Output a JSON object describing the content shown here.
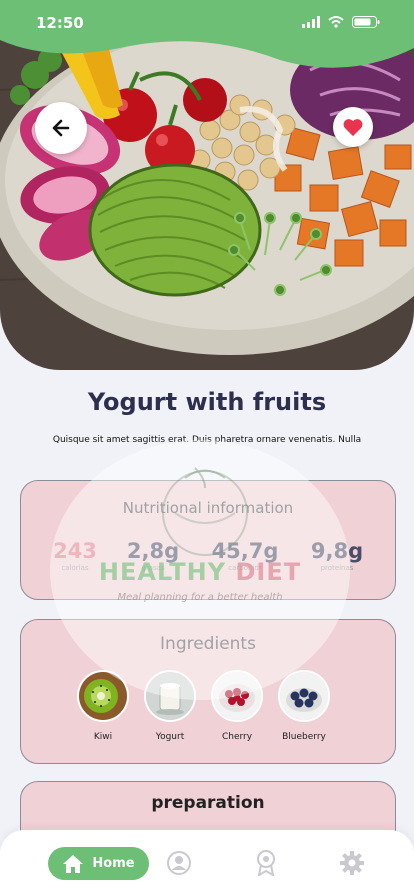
{
  "status": {
    "time": "12:50"
  },
  "recipe": {
    "title": "Yogurt with fruits",
    "description": "Quisque sit amet sagittis erat. Duis pharetra ornare venenatis. Nulla"
  },
  "nutrition": {
    "title": "Nutritional information",
    "items": [
      {
        "value": "243",
        "label": "calorias",
        "color": "#e07a88"
      },
      {
        "value": "2,8g",
        "label": "grasas",
        "color": "#4a4d66"
      },
      {
        "value": "45,7g",
        "label": "carbohidr",
        "color": "#4a4d66"
      },
      {
        "value": "9,8g",
        "label": "proteínas",
        "color": "#4a4d66"
      }
    ]
  },
  "ingredients": {
    "title": "Ingredients",
    "items": [
      {
        "label": "Kiwi",
        "icon": "kiwi-image"
      },
      {
        "label": "Yogurt",
        "icon": "yogurt-image"
      },
      {
        "label": "Cherry",
        "icon": "cherry-image"
      },
      {
        "label": "Blueberry",
        "icon": "blueberry-image"
      }
    ]
  },
  "preparation": {
    "title": "preparation"
  },
  "watermark": {
    "part1": "HEALTHY",
    "part2": "DIET",
    "tagline": "Meal planning for a better health"
  },
  "nav": {
    "home_label": "Home"
  },
  "colors": {
    "accent": "#6cbf74",
    "card": "#f0d1d6",
    "heart": "#e8344f"
  }
}
